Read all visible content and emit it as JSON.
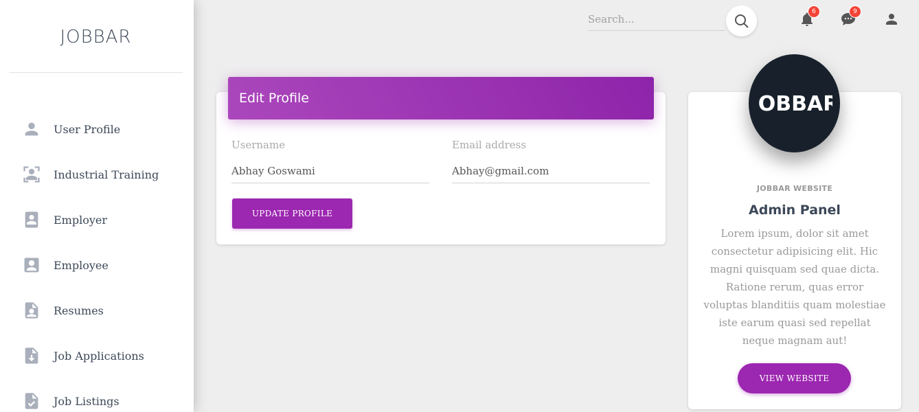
{
  "sidebar": {
    "brand": "JOBBAR",
    "items": [
      {
        "label": "User Profile",
        "icon": "person-icon"
      },
      {
        "label": "Industrial Training",
        "icon": "contact-frame-icon"
      },
      {
        "label": "Employer",
        "icon": "portrait-icon"
      },
      {
        "label": "Employee",
        "icon": "account-box-icon"
      },
      {
        "label": "Resumes",
        "icon": "resume-icon"
      },
      {
        "label": "Job Applications",
        "icon": "file-download-icon"
      },
      {
        "label": "Job Listings",
        "icon": "file-check-icon"
      }
    ]
  },
  "topbar": {
    "search_placeholder": "Search...",
    "notifications_count": "6",
    "messages_count": "9"
  },
  "edit_profile": {
    "title": "Edit Profile",
    "username_label": "Username",
    "username_value": "Abhay Goswami",
    "email_label": "Email address",
    "email_value": "Abhay@gmail.com",
    "update_button": "UPDATE PROFILE"
  },
  "profile_card": {
    "logo_text": "JOBBAR",
    "subtitle": "JOBBAR WEBSITE",
    "title": "Admin Panel",
    "description": "Lorem ipsum, dolor sit amet consectetur adipisicing elit. Hic magni quisquam sed quae dicta. Ratione rerum, quas error voluptas blanditiis quam molestiae iste earum quasi sed repellat neque magnam aut!",
    "view_button": "VIEW WEBSITE"
  },
  "colors": {
    "accent": "#9c27b0",
    "badge": "#f44336",
    "avatar_bg": "#18212b"
  }
}
